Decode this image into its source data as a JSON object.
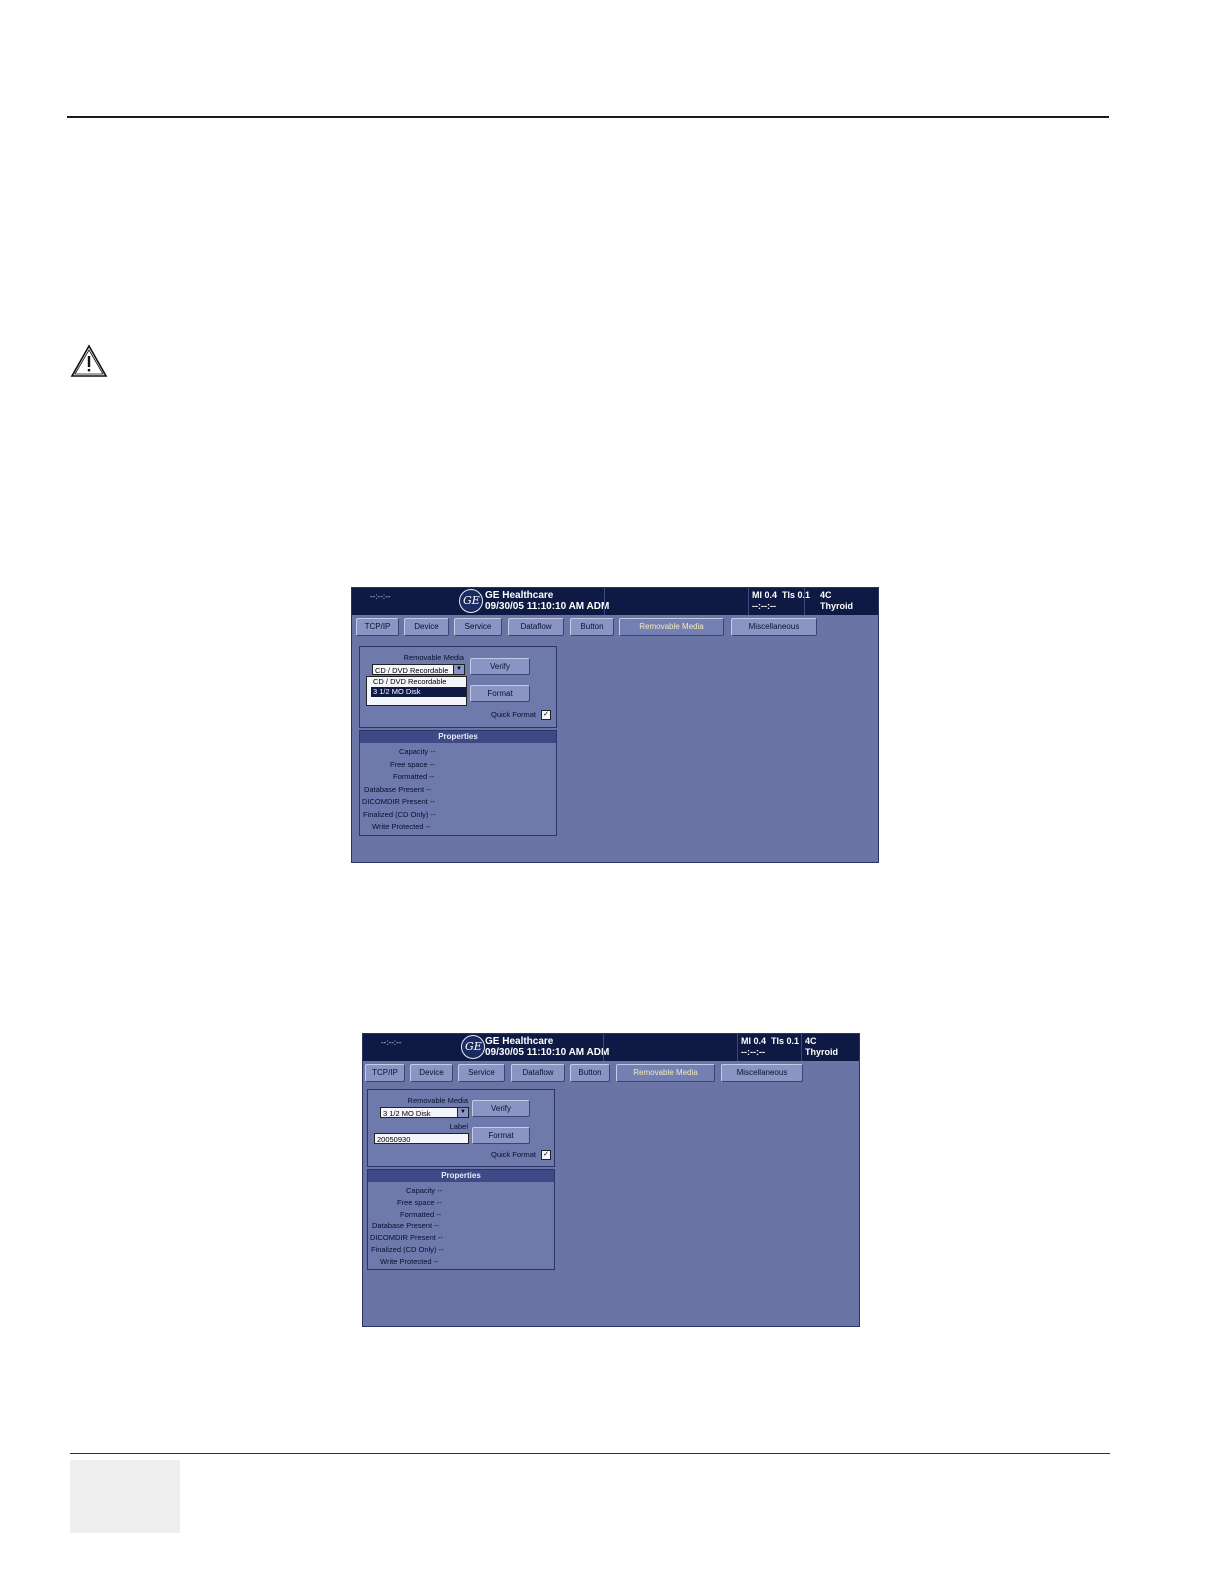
{
  "shots": [
    {
      "top_left": "--:--:--",
      "brand": "GE Healthcare",
      "datetime": "09/30/05 11:10:10 AM ADM",
      "mi": "MI 0.4",
      "tis": "TIs 0.1",
      "probe": "4C",
      "dashes": "--:--:--",
      "app": "Thyroid",
      "tabs": [
        "TCP/IP",
        "Device",
        "Service",
        "Dataflow",
        "Button",
        "Removable Media",
        "Miscellaneous"
      ],
      "removable_media_label": "Removable Media",
      "selected_media": "CD / DVD Recordable",
      "dropdown_options": [
        "CD / DVD Recordable",
        "3 1/2 MO Disk"
      ],
      "verify_label": "Verify",
      "format_label": "Format",
      "quick_format_label": "Quick Format",
      "quick_format_mark": "✓",
      "properties_title": "Properties",
      "properties": [
        "Capacity --",
        "Free space --",
        "Formatted --",
        "Database Present --",
        "DICOMDIR Present --",
        "Finalized (CD Only) --",
        "Write Protected --"
      ]
    },
    {
      "top_left": "--:--:--",
      "brand": "GE Healthcare",
      "datetime": "09/30/05 11:10:10 AM ADM",
      "mi": "MI 0.4",
      "tis": "TIs 0.1",
      "probe": "4C",
      "dashes": "--:--:--",
      "app": "Thyroid",
      "tabs": [
        "TCP/IP",
        "Device",
        "Service",
        "Dataflow",
        "Button",
        "Removable Media",
        "Miscellaneous"
      ],
      "removable_media_label": "Removable Media",
      "selected_media": "3 1/2 MO Disk",
      "label_label": "Label",
      "label_value": "20050930",
      "verify_label": "Verify",
      "format_label": "Format",
      "quick_format_label": "Quick Format",
      "quick_format_mark": "✓",
      "properties_title": "Properties",
      "properties": [
        "Capacity --",
        "Free space --",
        "Formatted --",
        "Database Present --",
        "DICOMDIR Present --",
        "Finalized (CD Only) --",
        "Write Protected --"
      ]
    }
  ]
}
